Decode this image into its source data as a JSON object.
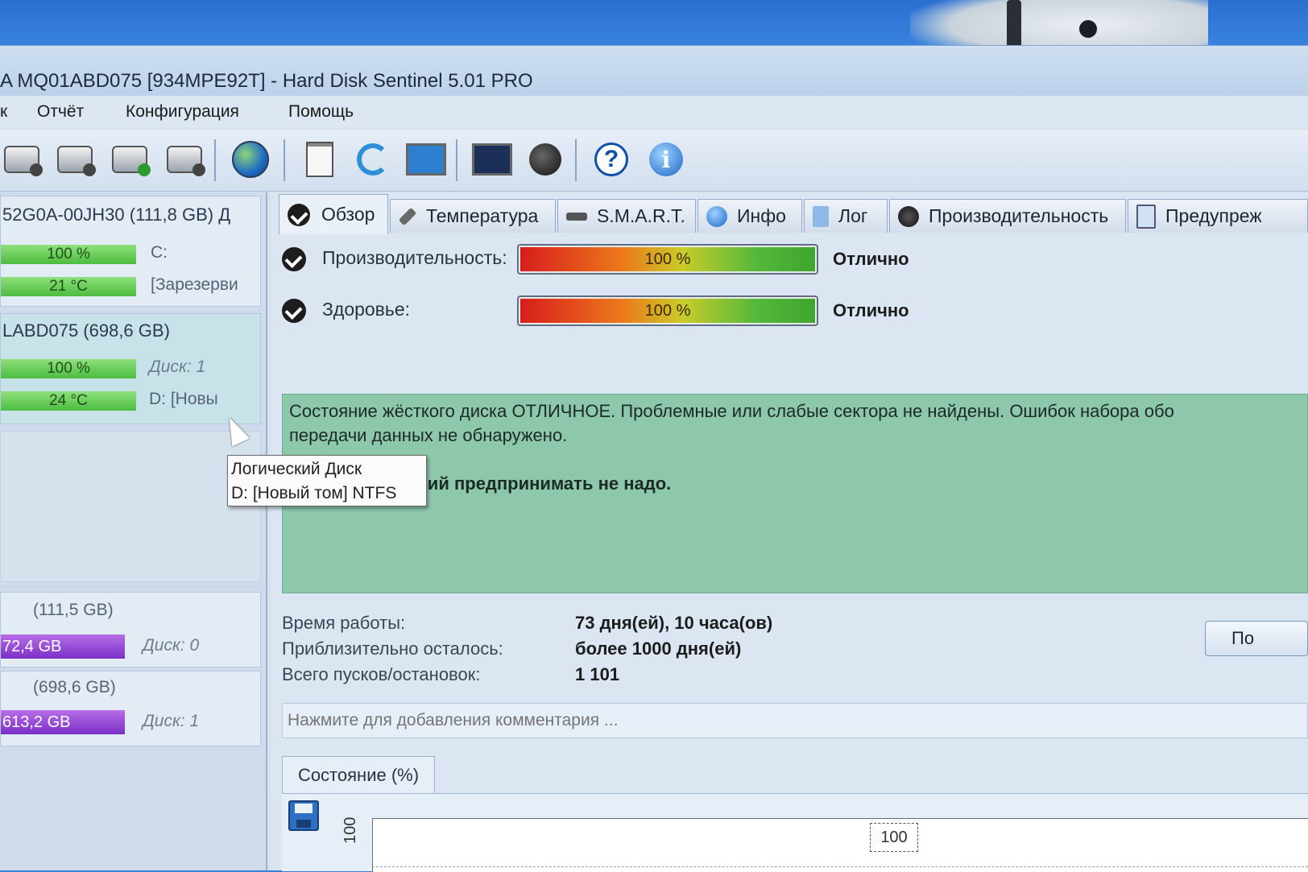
{
  "window": {
    "title": "A MQ01ABD075 [934MPE92T]  -  Hard Disk Sentinel 5.01 PRO"
  },
  "menu": [
    "к",
    "Отчёт",
    "Конфигурация",
    "Помощь"
  ],
  "toolbar": {
    "icons": [
      "disk-icon",
      "disk-clock-icon",
      "disk-check-icon",
      "disk-search-icon",
      "globe-icon",
      "document-icon",
      "refresh-icon",
      "monitor-icon",
      "monitor-alert-icon",
      "speaker-icon",
      "help-icon",
      "info-icon"
    ],
    "help_glyph": "?",
    "info_glyph": "i"
  },
  "sidebar": {
    "disks": [
      {
        "name": "52G0A-00JH30 (111,8 GB) Д",
        "health": "100 %",
        "temp": "21 °C",
        "vol1": "C:",
        "vol2": "[Зарезерви"
      },
      {
        "name": "LABD075 (698,6 GB)",
        "health": "100 %",
        "temp": "24 °C",
        "vol1": "Диск: 1",
        "vol2": "D: [Новы"
      }
    ],
    "volumes": [
      {
        "size": "(111,5 GB)",
        "free": "72,4 GB",
        "disk": "Диск: 0"
      },
      {
        "size": "(698,6 GB)",
        "free": "613,2 GB",
        "disk": "Диск: 1"
      }
    ],
    "tooltip": {
      "line1": "Логический Диск",
      "line2": "D: [Новый том] NTFS"
    }
  },
  "tabs": [
    {
      "label": "Обзор",
      "icon": "check-icon",
      "active": true
    },
    {
      "label": "Температура",
      "icon": "thermometer-icon"
    },
    {
      "label": "S.M.A.R.T.",
      "icon": "chip-icon"
    },
    {
      "label": "Инфо",
      "icon": "info-icon"
    },
    {
      "label": "Лог",
      "icon": "document-icon"
    },
    {
      "label": "Производительность",
      "icon": "gauge-icon"
    },
    {
      "label": "Предупреж",
      "icon": "copy-icon"
    }
  ],
  "overview": {
    "performance": {
      "label": "Производительность:",
      "value": "100 %",
      "fraction": 1.0,
      "rating": "Отлично"
    },
    "health": {
      "label": "Здоровье:",
      "value": "100 %",
      "fraction": 1.0,
      "rating": "Отлично"
    },
    "status_line1": "Состояние жёсткого диска ОТЛИЧНОЕ. Проблемные или слабые сектора не найдены. Ошибок набора обо",
    "status_line2": "передачи данных не обнаружено.",
    "status_advice": "Никаких действий предпринимать не надо.",
    "stats": [
      {
        "label": "Время работы:",
        "value": "73 дня(ей), 10 часа(ов)"
      },
      {
        "label": "Приблизительно осталось:",
        "value": "более 1000 дня(ей)"
      },
      {
        "label": "Всего пусков/остановок:",
        "value": "1 101"
      }
    ],
    "side_button": "По",
    "comment_placeholder": "Нажмите для добавления комментария ...",
    "status_tab": "Состояние (%)"
  },
  "chart_data": {
    "type": "line",
    "y_tick": "100",
    "point_label": "100",
    "values": [
      100
    ]
  },
  "colors": {
    "status_bg": "#8dc8ad",
    "bar_green": "#4cbc3f",
    "bar_purple": "#7a2fc7"
  }
}
